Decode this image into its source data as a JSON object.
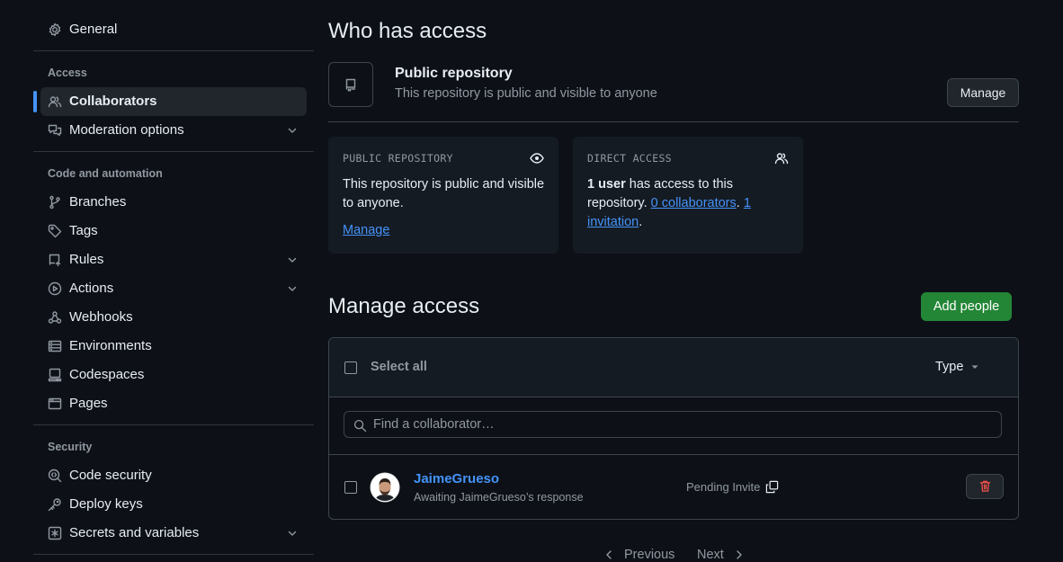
{
  "sidebar": {
    "general": "General",
    "sections": {
      "access": "Access",
      "code_automation": "Code and automation",
      "security": "Security"
    },
    "items": {
      "collaborators": "Collaborators",
      "moderation": "Moderation options",
      "branches": "Branches",
      "tags": "Tags",
      "rules": "Rules",
      "actions": "Actions",
      "webhooks": "Webhooks",
      "environments": "Environments",
      "codespaces": "Codespaces",
      "pages": "Pages",
      "code_security": "Code security",
      "deploy_keys": "Deploy keys",
      "secrets": "Secrets and variables"
    }
  },
  "who_has_access": {
    "title": "Who has access",
    "repo_type": "Public repository",
    "repo_desc": "This repository is public and visible to anyone",
    "manage_button": "Manage",
    "public_card": {
      "title": "PUBLIC REPOSITORY",
      "text": "This repository is public and visible to anyone.",
      "link": "Manage"
    },
    "direct_card": {
      "title": "DIRECT ACCESS",
      "users": "1 user",
      "text1": " has access to this repository. ",
      "collaborators_link": "0 collaborators",
      "sep": ". ",
      "invitation_link": "1 invitation",
      "end": "."
    }
  },
  "manage_access": {
    "title": "Manage access",
    "add_button": "Add people",
    "select_all": "Select all",
    "type_filter": "Type",
    "search_placeholder": "Find a collaborator…",
    "rows": [
      {
        "username": "JaimeGrueso",
        "subtitle": "Awaiting JaimeGrueso’s response",
        "status": "Pending Invite"
      }
    ]
  },
  "pagination": {
    "previous": "Previous",
    "next": "Next"
  },
  "colors": {
    "accent": "#4493f8",
    "add_button": "#238636",
    "danger": "#f85149",
    "background": "#0d1117"
  }
}
